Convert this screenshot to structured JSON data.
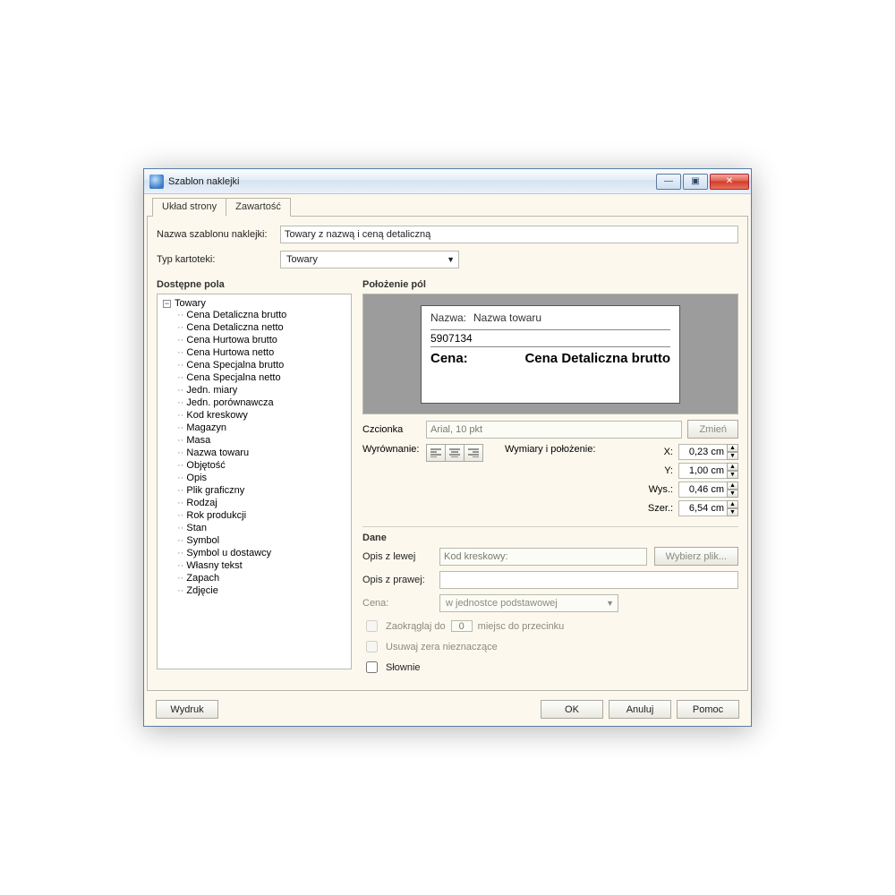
{
  "window": {
    "title": "Szablon naklejki"
  },
  "tabs": {
    "layout": "Układ strony",
    "content": "Zawartość"
  },
  "form": {
    "name_label": "Nazwa szablonu naklejki:",
    "name_value": "Towary z nazwą i ceną detaliczną",
    "type_label": "Typ kartoteki:",
    "type_value": "Towary"
  },
  "left": {
    "header": "Dostępne pola",
    "root": "Towary",
    "items": [
      "Cena Detaliczna brutto",
      "Cena Detaliczna netto",
      "Cena Hurtowa brutto",
      "Cena Hurtowa netto",
      "Cena Specjalna brutto",
      "Cena Specjalna netto",
      "Jedn. miary",
      "Jedn. porównawcza",
      "Kod kreskowy",
      "Magazyn",
      "Masa",
      "Nazwa towaru",
      "Objętość",
      "Opis",
      "Plik graficzny",
      "Rodzaj",
      "Rok produkcji",
      "Stan",
      "Symbol",
      "Symbol u dostawcy",
      "Własny tekst",
      "Zapach",
      "Zdjęcie"
    ]
  },
  "right": {
    "header": "Położenie pól",
    "preview": {
      "name_lbl": "Nazwa:",
      "name_val": "Nazwa towaru",
      "barcode": "5907134",
      "price_lbl": "Cena:",
      "price_val": "Cena Detaliczna brutto"
    },
    "font_label": "Czcionka",
    "font_value": "Arial, 10 pkt",
    "change": "Zmień",
    "align_label": "Wyrównanie:",
    "dims_label": "Wymiary i położenie:",
    "dims": {
      "x_k": "X:",
      "x": "0,23 cm",
      "y_k": "Y:",
      "y": "1,00 cm",
      "h_k": "Wys.:",
      "h": "0,46 cm",
      "w_k": "Szer.:",
      "w": "6,54 cm"
    },
    "dane": {
      "header": "Dane",
      "left_lbl": "Opis z lewej",
      "left_val": "Kod kreskowy:",
      "choose": "Wybierz plik...",
      "right_lbl": "Opis z prawej:",
      "right_val": "",
      "price_lbl": "Cena:",
      "price_unit": "w jednostce podstawowej",
      "round_pre": "Zaokrąglaj do",
      "round_val": "0",
      "round_post": "miejsc do przecinku",
      "strip": "Usuwaj zera nieznaczące",
      "words": "Słownie"
    }
  },
  "footer": {
    "print": "Wydruk",
    "ok": "OK",
    "cancel": "Anuluj",
    "help": "Pomoc"
  }
}
